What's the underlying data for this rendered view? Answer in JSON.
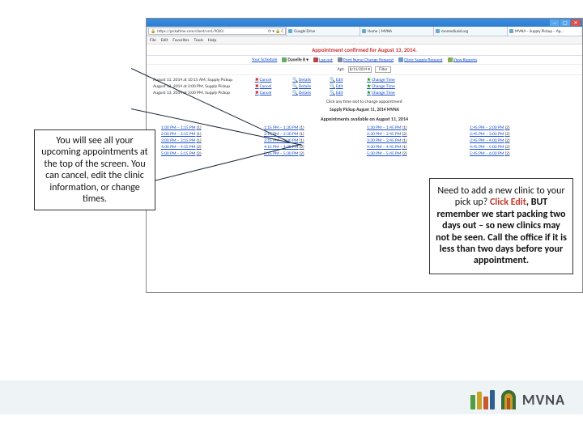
{
  "window": {
    "min": "—",
    "max": "▢",
    "close": "✕"
  },
  "address": {
    "url": "https://pickatime.com/client/vrs1/9020/",
    "controls": "⟳ ▾ 🔒 C"
  },
  "tabs": [
    {
      "fav": "#d8a",
      "label": "Google Drive"
    },
    {
      "fav": "#7bd",
      "label": "Home | MVNA"
    },
    {
      "fav": "#9c6",
      "label": "mnmedicaid.org"
    },
    {
      "fav": "#fb6",
      "label": "MVNA – Supply Pickup – Ap…"
    }
  ],
  "menu": [
    "File",
    "Edit",
    "Favorites",
    "Tools",
    "Help"
  ],
  "confirm": "Appointment confirmed for August 13, 2014.",
  "toolbar": {
    "schedule": "Your Schedule",
    "user_label": "Danelle B ▾",
    "logout": "Log out",
    "print": "Print Nurse Change Request",
    "clinic": "Clinic Supply Request",
    "reports": "View Reports"
  },
  "filter": {
    "date_label": "Apt.",
    "date_value": "8/11/2014 ▾",
    "btn": "Filter"
  },
  "appointments": [
    {
      "when": "August 11, 2014 at 10:15 AM, Supply Pickup"
    },
    {
      "when": "August 13, 2014 at 2:00 PM, Supply Pickup"
    },
    {
      "when": "August 13, 2014 at 3:00 PM, Supply Pickup"
    }
  ],
  "appt_actions": {
    "cancel": "Cancel",
    "details": "Details",
    "edit": "Edit",
    "change": "Change Time"
  },
  "click_hint": "Click any time slot to change appointment",
  "pickup_line": "Supply Pickup  August 11, 2014  MVNA",
  "avail_title": "Appointments available on August 11, 2014",
  "slots": [
    [
      "1:00 PM – 1:15 PM",
      "1:15 PM – 1:30 PM",
      "1:30 PM – 1:45 PM",
      "1:45 PM – 2:00 PM"
    ],
    [
      "2:00 PM – 2:15 PM",
      "2:15 PM – 2:30 PM",
      "2:30 PM – 2:45 PM",
      "2:45 PM – 3:00 PM"
    ],
    [
      "3:00 PM – 3:15 PM",
      "3:15 PM – 3:30 PM",
      "3:30 PM – 3:45 PM",
      "3:45 PM – 4:00 PM"
    ],
    [
      "4:00 PM – 4:15 PM",
      "4:15 PM – 4:30 PM",
      "4:30 PM – 4:45 PM",
      "4:45 PM – 5:00 PM"
    ],
    [
      "5:00 PM – 5:15 PM",
      "5:15 PM – 5:30 PM",
      "5:30 PM – 5:45 PM",
      "5:45 PM – 6:00 PM"
    ]
  ],
  "slot_counts": [
    [
      "(1)",
      "(1)",
      "(1)",
      "(2)"
    ],
    [
      "(1)",
      "(1)",
      "(2)",
      "(2)"
    ],
    [
      "(1)",
      "(1)",
      "(1)",
      "(2)"
    ],
    [
      "(2)",
      "(2)",
      "(1)",
      "(2)"
    ],
    [
      "(2)",
      "(2)",
      "(2)",
      "(2)"
    ]
  ],
  "note_left": "You will see all your upcoming appointments at the top of the screen. You can cancel, edit the clinic information, or change times.",
  "note_right": {
    "p1": "Need to add a new clinic to your pick up? ",
    "edit": "Click Edit",
    "p2": ", BUT remember we start packing two days out – so new clinics may not be seen.  Call the office if it is less than two days before your appointment."
  },
  "logo_text": "MVNA"
}
